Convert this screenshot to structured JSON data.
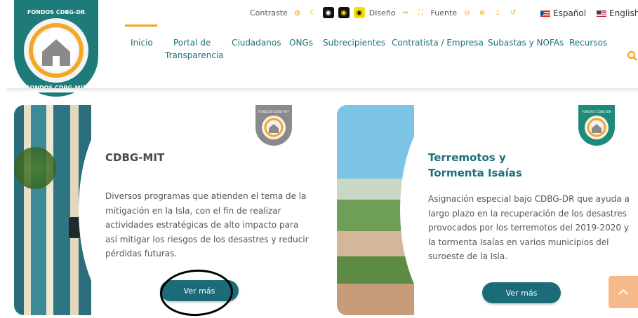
{
  "accessibility": {
    "contrast_label": "Contraste",
    "design_label": "Diseño",
    "font_label": "Fuente"
  },
  "languages": [
    {
      "label": "Español",
      "flag": "pr-flag-icon"
    },
    {
      "label": "English",
      "flag": "us-flag-icon"
    }
  ],
  "logo": {
    "top_text": "FONDOS CDBG-DR",
    "bottom_text": "FONDOS CDBG-MIT"
  },
  "nav": {
    "items": [
      {
        "line1": "Inicio",
        "line2": "",
        "active": true
      },
      {
        "line1": "Portal de",
        "line2": "Transparencia"
      },
      {
        "line1": "Ciudadanos",
        "line2": ""
      },
      {
        "line1": "ONGs",
        "line2": ""
      },
      {
        "line1": "Subrecipientes",
        "line2": ""
      },
      {
        "line1": "Contratista / Empresa",
        "line2": ""
      },
      {
        "line1": "Subastas y NOFAs",
        "line2": ""
      },
      {
        "line1": "Recursos",
        "line2": ""
      }
    ]
  },
  "cards": [
    {
      "title": "CDBG-MIT",
      "badge_text": "FONDOS CDBG-MIT",
      "text": "Diversos programas que atienden el tema de la mitigación en la Isla, con el fin de realizar actividades estratégicas de alto impacto para así mitigar los riesgos de los desastres y reducir pérdidas futuras.",
      "button": "Ver más"
    },
    {
      "title": "Terremotos y Tormenta Isaías",
      "badge_text": "FONDOS CDBG-DR",
      "text": "Asignación especial bajo CDBG-DR que ayuda a largo plazo en la recuperación de los desastres provocados por los terremotos del 2019-2020 y la tormenta Isaías en varios municipios del suroeste de la Isla.",
      "button": "Ver más"
    }
  ],
  "colors": {
    "teal": "#1b6c78",
    "orange": "#f5a623",
    "grey_badge": "#8a8a8a"
  }
}
